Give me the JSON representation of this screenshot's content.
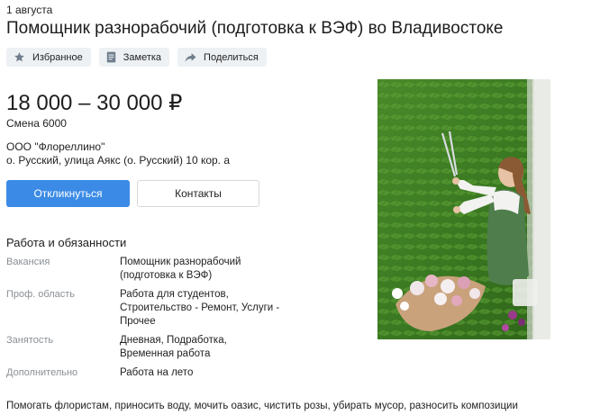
{
  "header": {
    "date": "1 августа",
    "title": "Помощник разнорабочий (подготовка к ВЭФ) во Владивостоке"
  },
  "actions": {
    "favorite_label": "Избранное",
    "note_label": "Заметка",
    "share_label": "Поделиться"
  },
  "job": {
    "salary": "18 000 – 30 000 ₽",
    "shift": "Смена 6000",
    "company": "ООО \"Флореллино\"",
    "address": "о. Русский, улица Аякс (о. Русский) 10 кор. а"
  },
  "buttons": {
    "apply_label": "Откликнуться",
    "contacts_label": "Контакты"
  },
  "details": {
    "section_title": "Работа и обязанности",
    "rows": [
      {
        "label": "Вакансия",
        "value_lines": [
          "Помощник разнорабочий",
          "(подготовка к ВЭФ)"
        ]
      },
      {
        "label": "Проф. область",
        "value_lines": [
          "Работа для студентов,",
          "Строительство - Ремонт, Услуги -",
          "Прочее"
        ]
      },
      {
        "label": "Занятость",
        "value_lines": [
          "Дневная, Подработка,",
          "Временная работа"
        ]
      },
      {
        "label": "Дополнительно",
        "value_lines": [
          "Работа на лето"
        ]
      }
    ]
  },
  "description": "Помогать флористам, приносить воду, мочить оазис, чистить розы, убирать мусор, разносить композиции",
  "icons": {
    "favorite": "star-icon",
    "note": "note-icon",
    "share": "share-arrow-icon"
  },
  "colors": {
    "primary_button": "#3b8be6",
    "action_button_bg": "#eef1f4",
    "muted_label": "#8a8f94"
  }
}
